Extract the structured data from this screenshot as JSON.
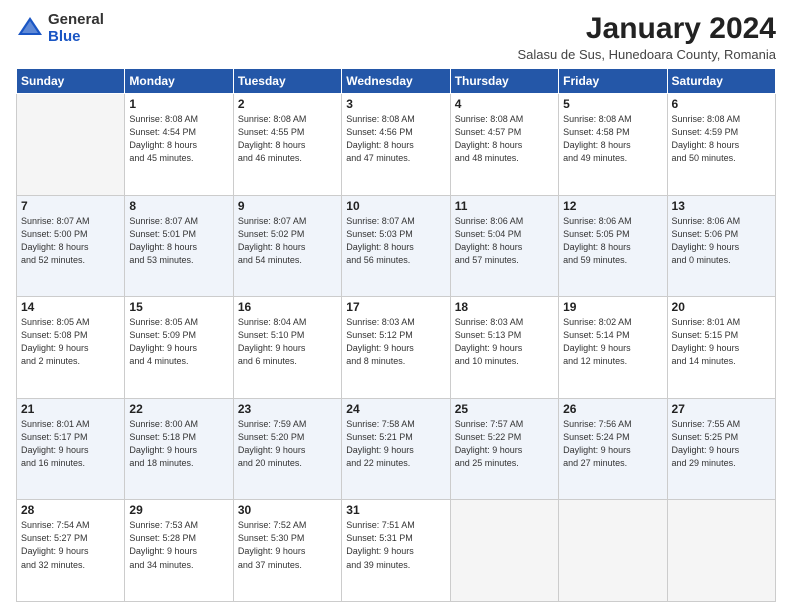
{
  "logo": {
    "general": "General",
    "blue": "Blue"
  },
  "header": {
    "month": "January 2024",
    "location": "Salasu de Sus, Hunedoara County, Romania"
  },
  "weekdays": [
    "Sunday",
    "Monday",
    "Tuesday",
    "Wednesday",
    "Thursday",
    "Friday",
    "Saturday"
  ],
  "weeks": [
    [
      {
        "day": "",
        "info": ""
      },
      {
        "day": "1",
        "info": "Sunrise: 8:08 AM\nSunset: 4:54 PM\nDaylight: 8 hours\nand 45 minutes."
      },
      {
        "day": "2",
        "info": "Sunrise: 8:08 AM\nSunset: 4:55 PM\nDaylight: 8 hours\nand 46 minutes."
      },
      {
        "day": "3",
        "info": "Sunrise: 8:08 AM\nSunset: 4:56 PM\nDaylight: 8 hours\nand 47 minutes."
      },
      {
        "day": "4",
        "info": "Sunrise: 8:08 AM\nSunset: 4:57 PM\nDaylight: 8 hours\nand 48 minutes."
      },
      {
        "day": "5",
        "info": "Sunrise: 8:08 AM\nSunset: 4:58 PM\nDaylight: 8 hours\nand 49 minutes."
      },
      {
        "day": "6",
        "info": "Sunrise: 8:08 AM\nSunset: 4:59 PM\nDaylight: 8 hours\nand 50 minutes."
      }
    ],
    [
      {
        "day": "7",
        "info": "Sunrise: 8:07 AM\nSunset: 5:00 PM\nDaylight: 8 hours\nand 52 minutes."
      },
      {
        "day": "8",
        "info": "Sunrise: 8:07 AM\nSunset: 5:01 PM\nDaylight: 8 hours\nand 53 minutes."
      },
      {
        "day": "9",
        "info": "Sunrise: 8:07 AM\nSunset: 5:02 PM\nDaylight: 8 hours\nand 54 minutes."
      },
      {
        "day": "10",
        "info": "Sunrise: 8:07 AM\nSunset: 5:03 PM\nDaylight: 8 hours\nand 56 minutes."
      },
      {
        "day": "11",
        "info": "Sunrise: 8:06 AM\nSunset: 5:04 PM\nDaylight: 8 hours\nand 57 minutes."
      },
      {
        "day": "12",
        "info": "Sunrise: 8:06 AM\nSunset: 5:05 PM\nDaylight: 8 hours\nand 59 minutes."
      },
      {
        "day": "13",
        "info": "Sunrise: 8:06 AM\nSunset: 5:06 PM\nDaylight: 9 hours\nand 0 minutes."
      }
    ],
    [
      {
        "day": "14",
        "info": "Sunrise: 8:05 AM\nSunset: 5:08 PM\nDaylight: 9 hours\nand 2 minutes."
      },
      {
        "day": "15",
        "info": "Sunrise: 8:05 AM\nSunset: 5:09 PM\nDaylight: 9 hours\nand 4 minutes."
      },
      {
        "day": "16",
        "info": "Sunrise: 8:04 AM\nSunset: 5:10 PM\nDaylight: 9 hours\nand 6 minutes."
      },
      {
        "day": "17",
        "info": "Sunrise: 8:03 AM\nSunset: 5:12 PM\nDaylight: 9 hours\nand 8 minutes."
      },
      {
        "day": "18",
        "info": "Sunrise: 8:03 AM\nSunset: 5:13 PM\nDaylight: 9 hours\nand 10 minutes."
      },
      {
        "day": "19",
        "info": "Sunrise: 8:02 AM\nSunset: 5:14 PM\nDaylight: 9 hours\nand 12 minutes."
      },
      {
        "day": "20",
        "info": "Sunrise: 8:01 AM\nSunset: 5:15 PM\nDaylight: 9 hours\nand 14 minutes."
      }
    ],
    [
      {
        "day": "21",
        "info": "Sunrise: 8:01 AM\nSunset: 5:17 PM\nDaylight: 9 hours\nand 16 minutes."
      },
      {
        "day": "22",
        "info": "Sunrise: 8:00 AM\nSunset: 5:18 PM\nDaylight: 9 hours\nand 18 minutes."
      },
      {
        "day": "23",
        "info": "Sunrise: 7:59 AM\nSunset: 5:20 PM\nDaylight: 9 hours\nand 20 minutes."
      },
      {
        "day": "24",
        "info": "Sunrise: 7:58 AM\nSunset: 5:21 PM\nDaylight: 9 hours\nand 22 minutes."
      },
      {
        "day": "25",
        "info": "Sunrise: 7:57 AM\nSunset: 5:22 PM\nDaylight: 9 hours\nand 25 minutes."
      },
      {
        "day": "26",
        "info": "Sunrise: 7:56 AM\nSunset: 5:24 PM\nDaylight: 9 hours\nand 27 minutes."
      },
      {
        "day": "27",
        "info": "Sunrise: 7:55 AM\nSunset: 5:25 PM\nDaylight: 9 hours\nand 29 minutes."
      }
    ],
    [
      {
        "day": "28",
        "info": "Sunrise: 7:54 AM\nSunset: 5:27 PM\nDaylight: 9 hours\nand 32 minutes."
      },
      {
        "day": "29",
        "info": "Sunrise: 7:53 AM\nSunset: 5:28 PM\nDaylight: 9 hours\nand 34 minutes."
      },
      {
        "day": "30",
        "info": "Sunrise: 7:52 AM\nSunset: 5:30 PM\nDaylight: 9 hours\nand 37 minutes."
      },
      {
        "day": "31",
        "info": "Sunrise: 7:51 AM\nSunset: 5:31 PM\nDaylight: 9 hours\nand 39 minutes."
      },
      {
        "day": "",
        "info": ""
      },
      {
        "day": "",
        "info": ""
      },
      {
        "day": "",
        "info": ""
      }
    ]
  ]
}
